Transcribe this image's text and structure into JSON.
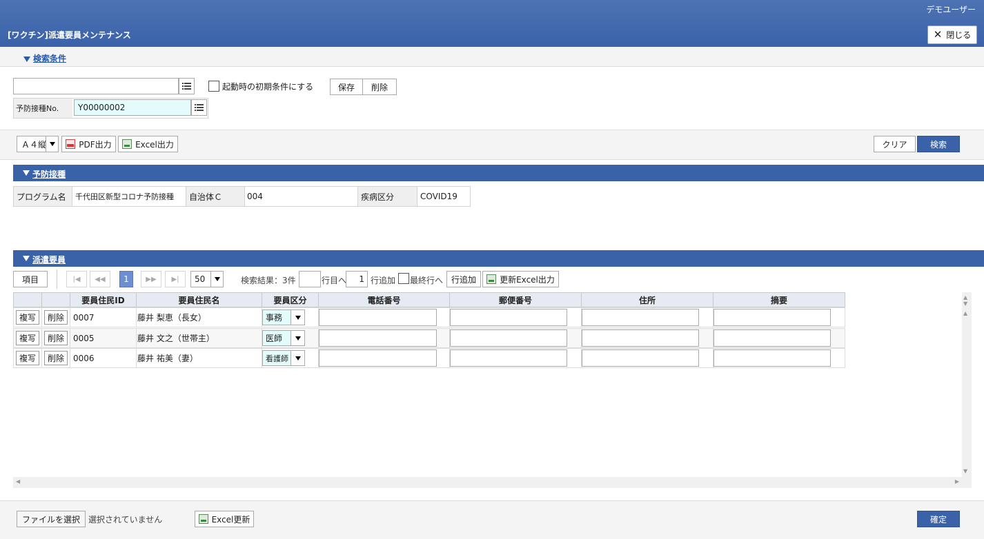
{
  "header": {
    "user_name": "デモユーザー",
    "title": "[ワクチン]派遣要員メンテナンス",
    "close_label": "閉じる"
  },
  "search": {
    "section_title": "検索条件",
    "condition_name_value": "",
    "startup_checkbox_label": "起動時の初期条件にする",
    "save_label": "保存",
    "delete_label": "削除",
    "field_label": "予防接種No.",
    "field_value": "Y00000002"
  },
  "toolbar": {
    "paper_size": "Ａ４縦",
    "pdf_label": "PDF出力",
    "excel_label": "Excel出力",
    "clear_label": "クリア",
    "search_label": "検索"
  },
  "vaccination": {
    "section_title": "予防接種",
    "program_label": "プログラム名",
    "program_value": "千代田区新型コロナ予防接種",
    "municipality_label": "自治体Ｃ",
    "municipality_value": "004",
    "disease_label": "疾病区分",
    "disease_value": "COVID19"
  },
  "staff": {
    "section_title": "派遣要員",
    "items_label": "項目",
    "current_page": "1",
    "page_size": "50",
    "result_text": "検索結果：3件",
    "goto_row_value": "",
    "goto_row_label": "行目へ",
    "add_count_value": "1",
    "add_row_label": "行追加",
    "last_row_label": "最終行へ",
    "add_row_button": "行追加",
    "update_excel_label": "更新Excel出力",
    "columns": [
      "要員住民ID",
      "要員住民名",
      "要員区分",
      "電話番号",
      "郵便番号",
      "住所",
      "摘要"
    ],
    "copy_label": "複写",
    "row_delete_label": "削除",
    "rows": [
      {
        "id": "0007",
        "name": "藤井 梨恵（長女）",
        "type": "事務"
      },
      {
        "id": "0005",
        "name": "藤井 文之（世帯主）",
        "type": "医師"
      },
      {
        "id": "0006",
        "name": "藤井 祐美（妻）",
        "type": "看護師"
      }
    ]
  },
  "footer": {
    "choose_file_label": "ファイルを選択",
    "no_file_text": "選択されていません",
    "excel_update_label": "Excel更新",
    "confirm_label": "確定"
  }
}
